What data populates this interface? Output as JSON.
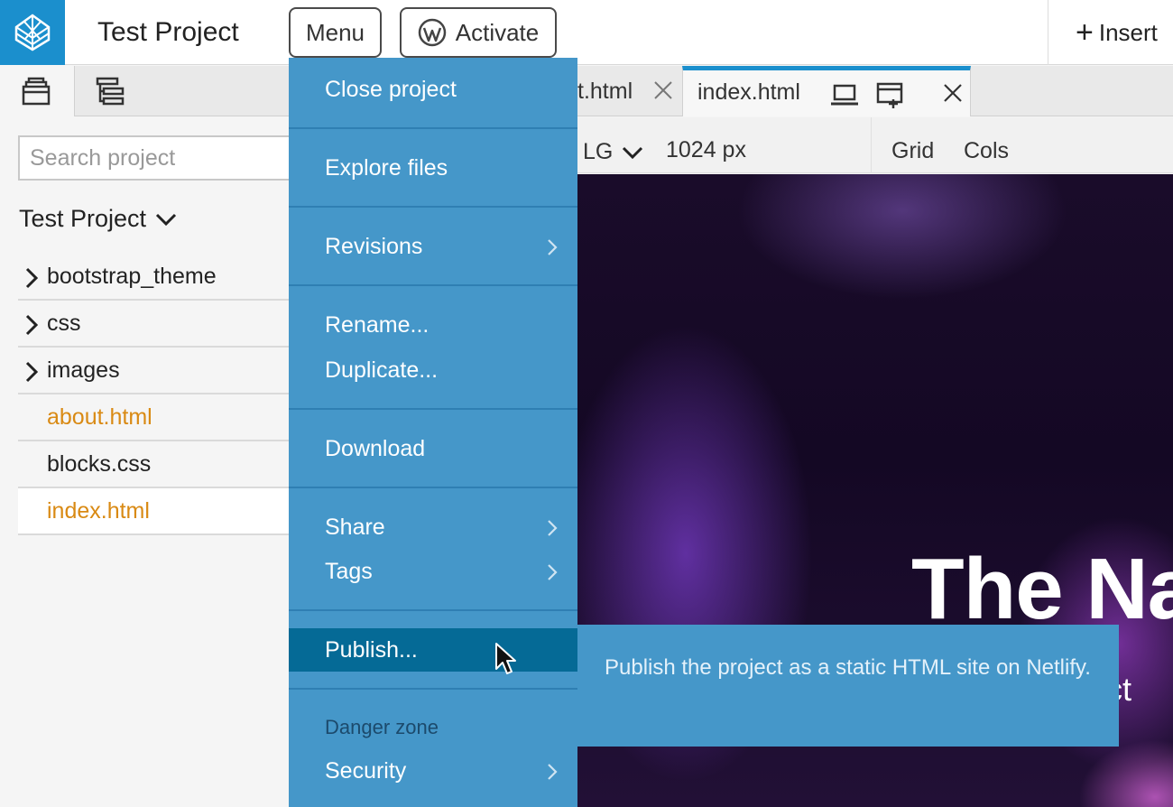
{
  "app": {
    "project_title": "Test Project"
  },
  "topbar": {
    "menu_label": "Menu",
    "activate_label": "Activate",
    "insert_label": "Insert"
  },
  "left_panel": {
    "search_placeholder": "Search project",
    "project_name": "Test Project",
    "files": [
      {
        "name": "bootstrap_theme",
        "type": "folder"
      },
      {
        "name": "css",
        "type": "folder"
      },
      {
        "name": "images",
        "type": "folder"
      },
      {
        "name": "about.html",
        "type": "file",
        "highlight": true
      },
      {
        "name": "blocks.css",
        "type": "file",
        "highlight": false
      },
      {
        "name": "index.html",
        "type": "file",
        "highlight": true,
        "selected": true
      }
    ]
  },
  "editor": {
    "tabs": [
      {
        "label": "t.html"
      },
      {
        "label": "index.html",
        "active": true
      }
    ],
    "toolbar": {
      "breakpoint": "LG",
      "width": "1024 px",
      "grid": "Grid",
      "cols": "Cols"
    },
    "canvas": {
      "hero_title": "The Na",
      "hero_sub": "act"
    }
  },
  "menu": {
    "items": [
      {
        "label": "Close project"
      },
      {
        "label": "Explore files"
      },
      {
        "label": "Revisions",
        "submenu": true
      },
      {
        "label": "Rename..."
      },
      {
        "label": "Duplicate..."
      },
      {
        "label": "Download"
      },
      {
        "label": "Share",
        "submenu": true
      },
      {
        "label": "Tags",
        "submenu": true
      },
      {
        "label": "Publish...",
        "active": true
      },
      {
        "label": "Security",
        "submenu": true
      }
    ],
    "section_label": "Danger zone"
  },
  "tooltip": {
    "text": "Publish the project as a static HTML site on Netlify."
  },
  "colors": {
    "accent": "#1b8fcd",
    "menu_bg": "#4597c9",
    "menu_active": "#056a96",
    "file_highlight": "#d98a14"
  }
}
